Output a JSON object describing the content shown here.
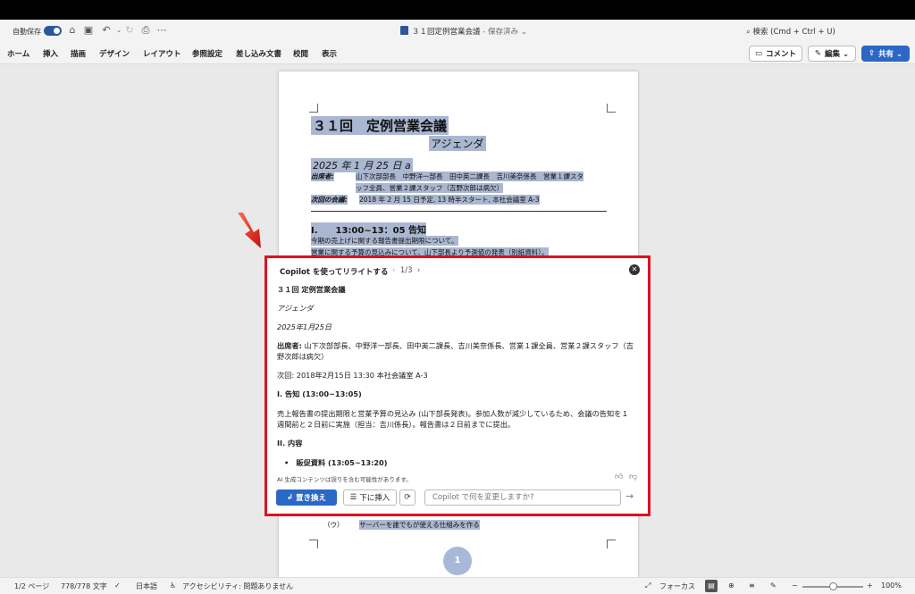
{
  "titlebar": {
    "autosave_label": "自動保存",
    "doc_name": "３１回定例営業会議",
    "saved_status": " - 保存済み ⌄",
    "search_placeholder": "検索 (Cmd + Ctrl + U)"
  },
  "ribbon": {
    "tabs": [
      "ホーム",
      "挿入",
      "描画",
      "デザイン",
      "レイアウト",
      "参照設定",
      "差し込み文書",
      "校閲",
      "表示"
    ],
    "comment_label": "コメント",
    "edit_label": "編集 ⌄",
    "share_label": "共有 ⌄"
  },
  "document": {
    "heading": "３１回　定例営業会議",
    "subheading": "アジェンダ",
    "date": "2025 年 1 月 25 日 a",
    "attendees_label": "出席者:",
    "attendees_line1": "山下次部部長　中野洋一部長　田中英二課長　吉川美奈係長　営業１課スタ",
    "attendees_line2": "ッフ全員、営業２課スタッフ（吉野次郎は病欠）",
    "next_label": "次回の会議:",
    "next_value": "2018 年 2 月 15 日予定, 13 時半スタート, 本社会議室 A-3",
    "section1": "I.　　13:00~13：05 告知",
    "section1_line1": "今期の売上げに関する報告書提出期限について。",
    "section1_line2": "営業に関する予算の見込みについて、山下部長より予測値の発表（別紙資料）。",
    "bottom_item_label": "（ウ）",
    "bottom_item_text": "サーバーを誰でもが使える仕組みを作る",
    "page_number": "1"
  },
  "copilot": {
    "title": "Copilot を使ってリライトする",
    "pager": "1/3",
    "lines": {
      "l1": "３１回 定例営業会議",
      "l2": "アジェンダ",
      "l3": "2025年1月25日",
      "l4_label": "出席者:",
      "l4_text": " 山下次部部長、中野洋一部長、田中英二課長、吉川美奈係長、営業１課全員、営業２課スタッフ（吉野次郎は病欠）",
      "l5": "次回: 2018年2月15日 13:30 本社会議室 A-3",
      "l6": "I. 告知 (13:00~13:05)",
      "l7": "売上報告書の提出期限と営業予算の見込み (山下部長発表)。参加人数が減少しているため、会議の告知を１週間前と２日前に実施（担当：吉川係長）。報告書は２日前までに提出。",
      "l8": "II. 内容",
      "l9": "•　販促資料 (13:05~13:20)"
    },
    "disclaimer": "AI 生成コンテンツは誤りを含む可能性があります。",
    "replace_label": "置き換え",
    "insert_label": "下に挿入",
    "input_placeholder": "Copilot で何を変更しますか?"
  },
  "statusbar": {
    "page": "1/2 ページ",
    "words": "778/778 文字",
    "language": "日本語",
    "accessibility": "アクセシビリティ: 問題ありません",
    "focus": "フォーカス",
    "zoom": "100%"
  },
  "colors": {
    "accent": "#2b67c4",
    "highlight_border": "#e0101f",
    "selection": "#aab7d1"
  }
}
